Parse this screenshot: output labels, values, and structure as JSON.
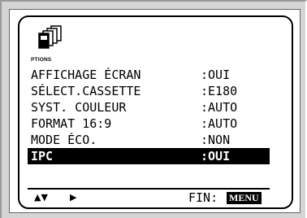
{
  "menu": {
    "icon_name": "cassette-stack-icon",
    "icon_label": "PTIONS",
    "items": [
      {
        "label": "AFFICHAGE ÉCRAN",
        "value": ":OUI",
        "selected": false
      },
      {
        "label": "SÉLECT.CASSETTE",
        "value": ":E180",
        "selected": false
      },
      {
        "label": "SYST. COULEUR",
        "value": ":AUTO",
        "selected": false
      },
      {
        "label": "FORMAT 16:9",
        "value": ":AUTO",
        "selected": false
      },
      {
        "label": "MODE ÉCO.",
        "value": ":NON",
        "selected": false
      },
      {
        "label": "IPC",
        "value": ":OUI",
        "selected": true
      }
    ]
  },
  "footer": {
    "nav_up_down": "▲▼",
    "nav_right": "▶",
    "fin_label": "FIN:",
    "menu_key": "MENU"
  },
  "colors": {
    "highlight_bg": "#000000",
    "highlight_text": "#ffffff",
    "screen_bg": "#ffffff",
    "frame_bg": "#d5d5d5"
  }
}
